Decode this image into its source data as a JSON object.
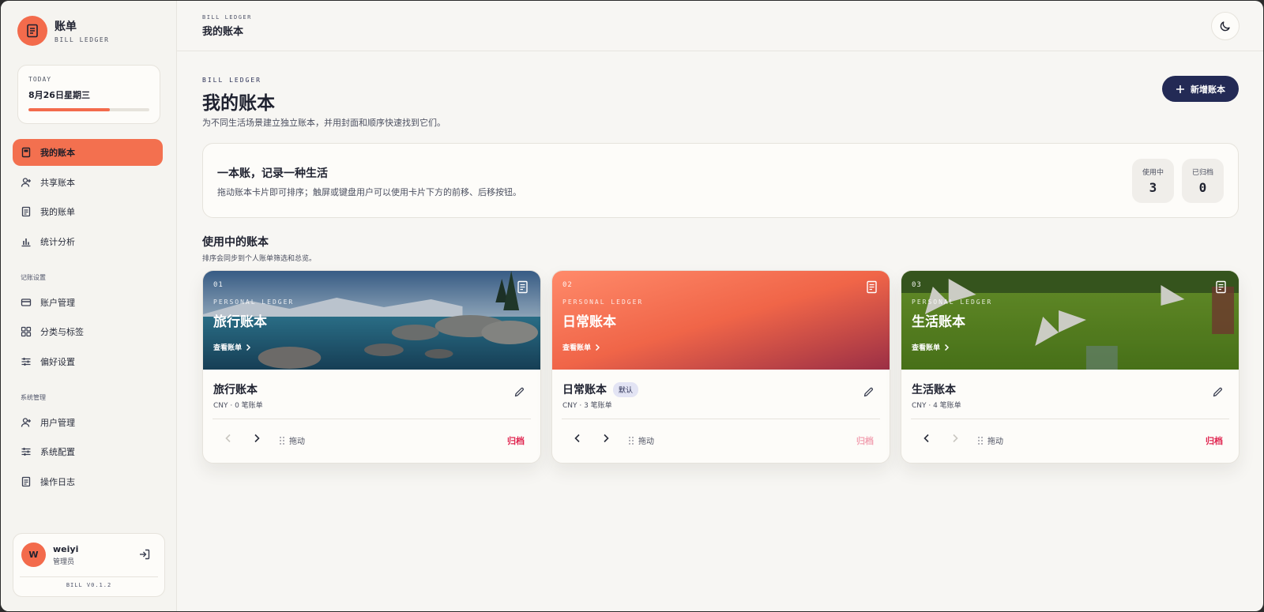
{
  "brand": {
    "title": "账单",
    "subtitle": "BILL LEDGER"
  },
  "today": {
    "label": "TODAY",
    "date": "8月26日星期三",
    "progress": 0.67
  },
  "nav": {
    "primary": [
      {
        "label": "我的账本",
        "icon": "book-icon",
        "active": true
      },
      {
        "label": "共享账本",
        "icon": "user-plus-icon"
      },
      {
        "label": "我的账单",
        "icon": "receipt-icon"
      },
      {
        "label": "统计分析",
        "icon": "bar-chart-icon"
      }
    ],
    "settings_section": "记账设置",
    "settings": [
      {
        "label": "账户管理",
        "icon": "credit-card-icon"
      },
      {
        "label": "分类与标签",
        "icon": "grid-icon"
      },
      {
        "label": "偏好设置",
        "icon": "sliders-icon"
      }
    ],
    "system_section": "系统管理",
    "system": [
      {
        "label": "用户管理",
        "icon": "user-plus-icon"
      },
      {
        "label": "系统配置",
        "icon": "sliders-icon"
      },
      {
        "label": "操作日志",
        "icon": "receipt-icon"
      }
    ]
  },
  "user": {
    "initial": "W",
    "name": "weiyi",
    "role": "管理员",
    "version": "BILL V0.1.2"
  },
  "topbar": {
    "eyebrow": "BILL LEDGER",
    "title": "我的账本"
  },
  "page": {
    "eyebrow": "BILL LEDGER",
    "title": "我的账本",
    "description": "为不同生活场景建立独立账本，并用封面和顺序快速找到它们。",
    "add_button": "新增账本"
  },
  "banner": {
    "title": "一本账，记录一种生活",
    "description": "拖动账本卡片即可排序；触屏或键盘用户可以使用卡片下方的前移、后移按钮。",
    "stats": [
      {
        "label": "使用中",
        "value": "3"
      },
      {
        "label": "已归档",
        "value": "0"
      }
    ]
  },
  "section": {
    "title": "使用中的账本",
    "description": "排序会同步到个人账单筛选和总览。"
  },
  "cards": [
    {
      "num": "01",
      "eyebrow": "PERSONAL LEDGER",
      "cover_title": "旅行账本",
      "link": "查看账单",
      "name": "旅行账本",
      "badge": "",
      "meta": "CNY · 0 笔账单",
      "drag": "拖动",
      "archive": "归档",
      "prev_enabled": false,
      "next_enabled": true,
      "archive_enabled": true,
      "cover": "lake"
    },
    {
      "num": "02",
      "eyebrow": "PERSONAL LEDGER",
      "cover_title": "日常账本",
      "link": "查看账单",
      "name": "日常账本",
      "badge": "默认",
      "meta": "CNY · 3 笔账单",
      "drag": "拖动",
      "archive": "归档",
      "prev_enabled": true,
      "next_enabled": true,
      "archive_enabled": false,
      "cover": "gradient"
    },
    {
      "num": "03",
      "eyebrow": "PERSONAL LEDGER",
      "cover_title": "生活账本",
      "link": "查看账单",
      "name": "生活账本",
      "badge": "",
      "meta": "CNY · 4 笔账单",
      "drag": "拖动",
      "archive": "归档",
      "prev_enabled": true,
      "next_enabled": false,
      "archive_enabled": true,
      "cover": "pinwheel"
    }
  ],
  "colors": {
    "accent": "#f36b4c",
    "navy": "#232a55",
    "danger": "#e0244f",
    "background": "#f7f6f3"
  }
}
